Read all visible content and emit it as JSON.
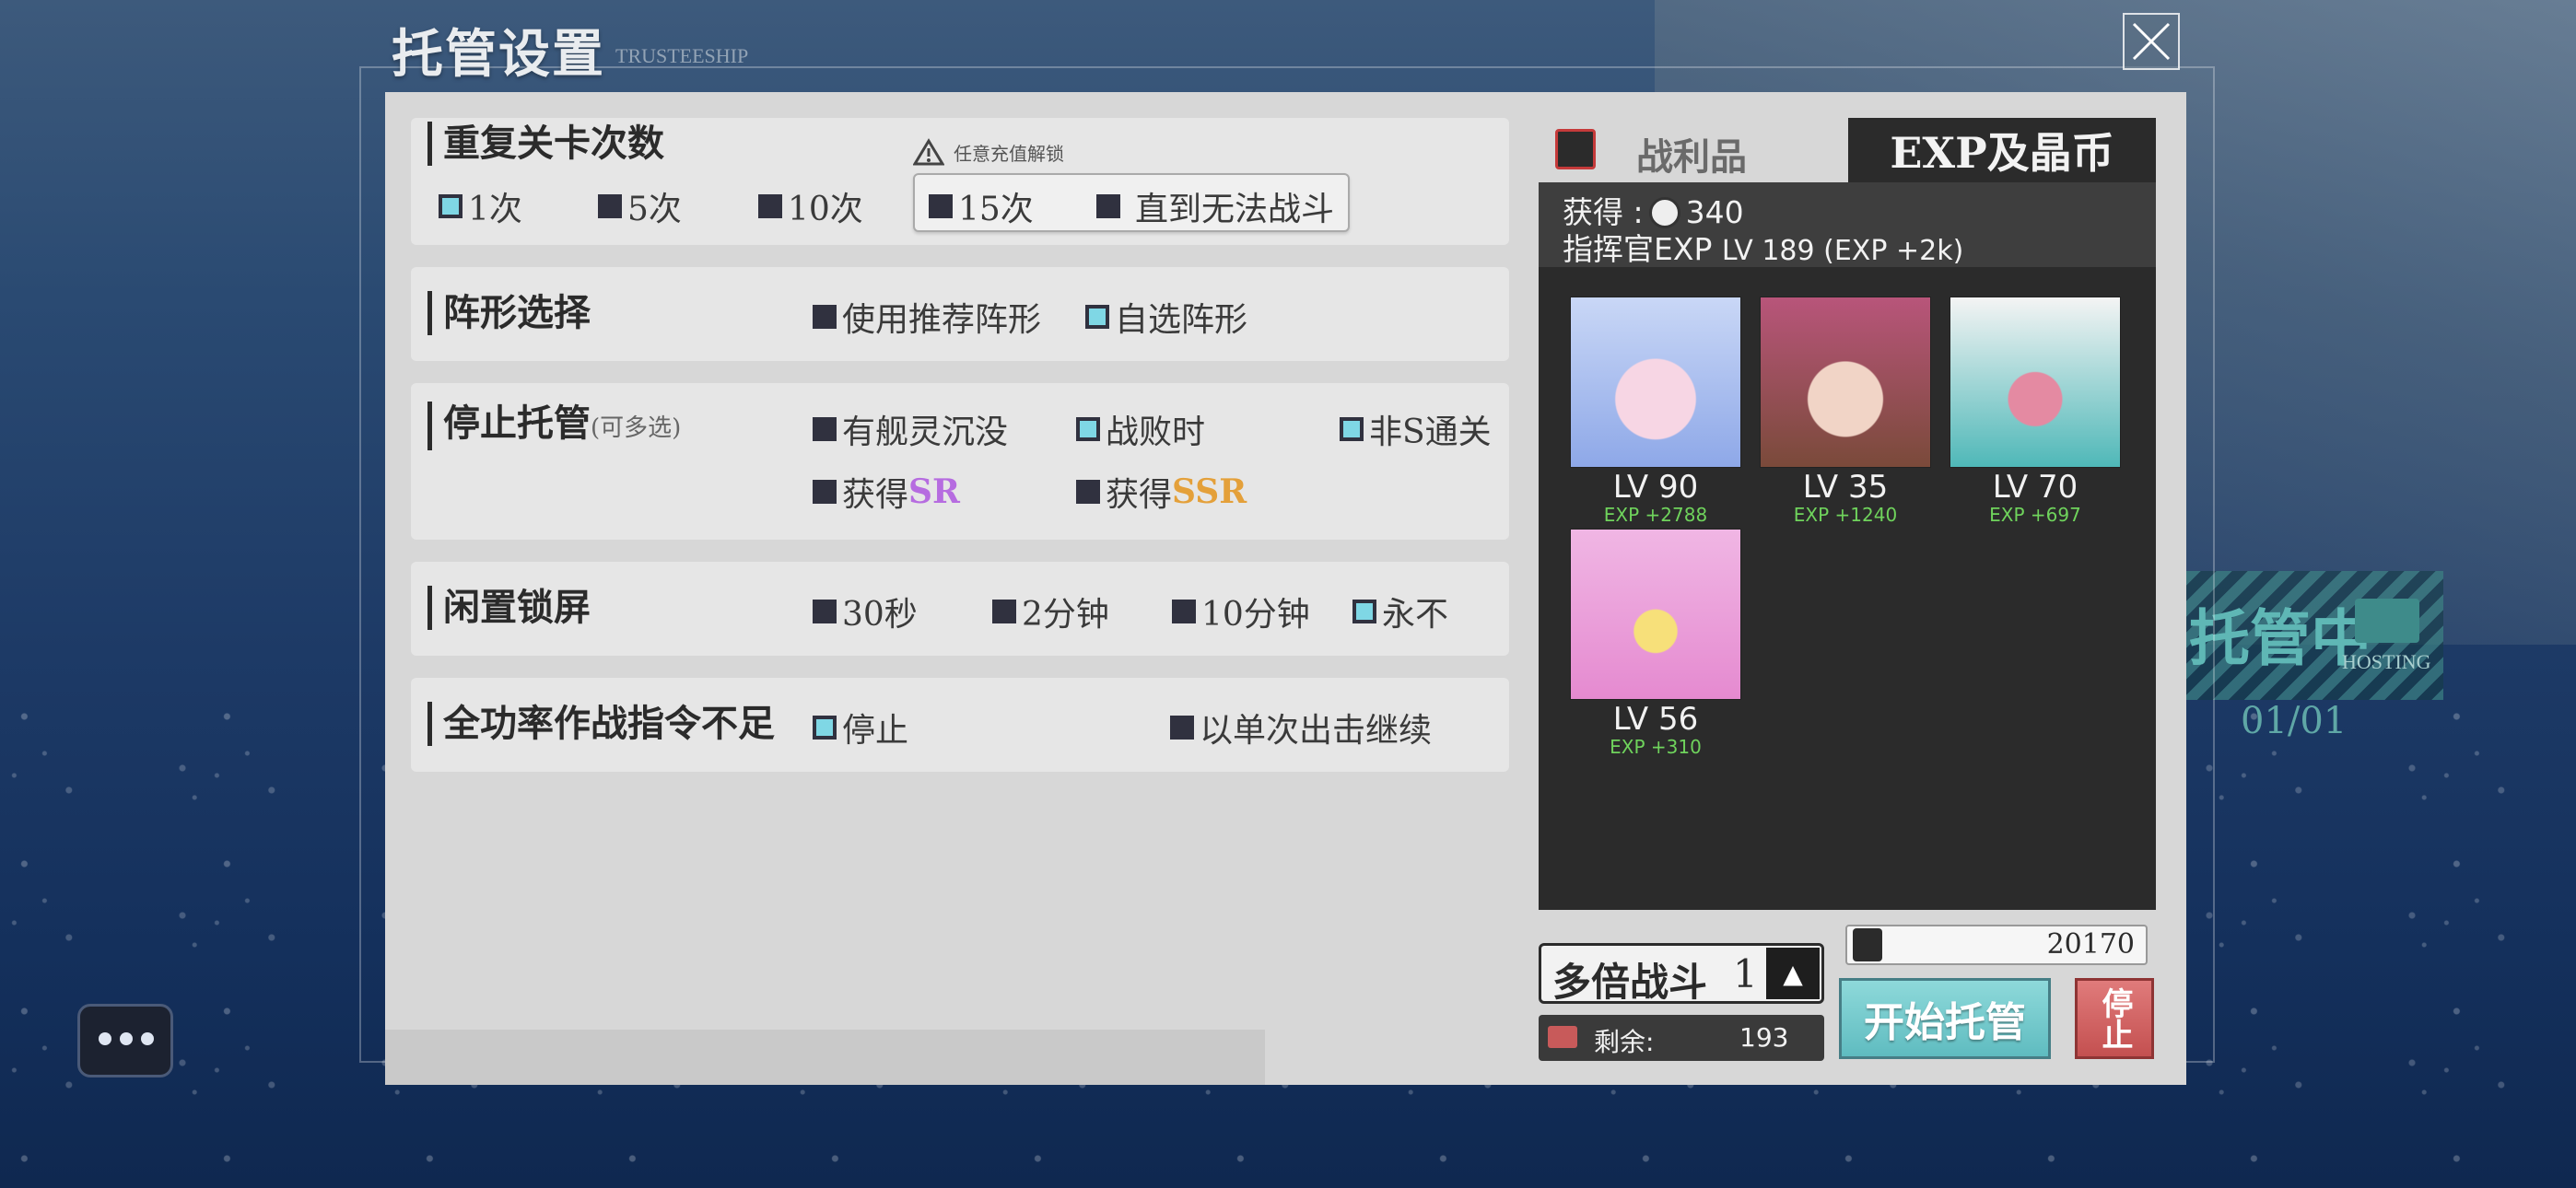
{
  "header": {
    "title": "托管设置",
    "title_en": "TRUSTEESHIP"
  },
  "repeat": {
    "title": "重复关卡次数",
    "lock_note": "任意充值解锁",
    "options": [
      {
        "label": "1次",
        "checked": true
      },
      {
        "label": "5次",
        "checked": false
      },
      {
        "label": "10次",
        "checked": false
      },
      {
        "label": "15次",
        "checked": false
      },
      {
        "label": "直到无法战斗",
        "checked": false
      }
    ]
  },
  "formation": {
    "title": "阵形选择",
    "options": [
      {
        "label": "使用推荐阵形",
        "checked": false
      },
      {
        "label": "自选阵形",
        "checked": true
      }
    ]
  },
  "stop": {
    "title": "停止托管",
    "subtitle": "(可多选)",
    "options": [
      {
        "label": "有舰灵沉没",
        "checked": false
      },
      {
        "label": "战败时",
        "checked": true
      },
      {
        "label": "非S通关",
        "checked": true
      },
      {
        "label_prefix": "获得",
        "label_hl": "SR",
        "checked": false
      },
      {
        "label_prefix": "获得",
        "label_hl": "SSR",
        "checked": false
      }
    ]
  },
  "idle": {
    "title": "闲置锁屏",
    "options": [
      {
        "label": "30秒",
        "checked": false
      },
      {
        "label": "2分钟",
        "checked": false
      },
      {
        "label": "10分钟",
        "checked": false
      },
      {
        "label": "永不",
        "checked": true
      }
    ]
  },
  "fullpower": {
    "title": "全功率作战指令不足",
    "options": [
      {
        "label": "停止",
        "checked": true
      },
      {
        "label": "以单次出击继续",
        "checked": false
      }
    ]
  },
  "tabs": {
    "loot": "战利品",
    "exp": "EXP及晶币"
  },
  "rewards": {
    "gain_label": "获得 :",
    "gain_value": "340",
    "commander_label": "指挥官EXP",
    "commander_value": "LV 189 (EXP +2k)"
  },
  "characters": [
    {
      "lv": "LV 90",
      "exp": "EXP +2788",
      "colors": [
        "#c9d7f6",
        "#8ea8e8",
        "#f7d6e4"
      ]
    },
    {
      "lv": "LV 35",
      "exp": "EXP +1240",
      "colors": [
        "#b8557a",
        "#7a4a3a",
        "#f1d4c6"
      ]
    },
    {
      "lv": "LV 70",
      "exp": "EXP +697",
      "colors": [
        "#f4f4f4",
        "#4fb8b8",
        "#e48aa2"
      ]
    },
    {
      "lv": "LV 56",
      "exp": "EXP +310",
      "colors": [
        "#f0b6e4",
        "#e58ad0",
        "#f7e07a"
      ]
    }
  ],
  "multi": {
    "label": "多倍战斗",
    "value": "1",
    "up": "▲"
  },
  "remain": {
    "label": "剩余:",
    "value": "193"
  },
  "coins": {
    "value": "20170"
  },
  "buttons": {
    "start": "开始托管",
    "stop": "停止"
  },
  "hosting": {
    "label": "托管中",
    "label_en": "HOSTING",
    "count": "01/01"
  },
  "colors": {
    "accent": "#7fd7e5",
    "panel": "#d7d7d7",
    "dark": "#2b2b2b",
    "sr": "#b66ce0",
    "ssr": "#e4a03a",
    "exp": "#6fd35c"
  }
}
